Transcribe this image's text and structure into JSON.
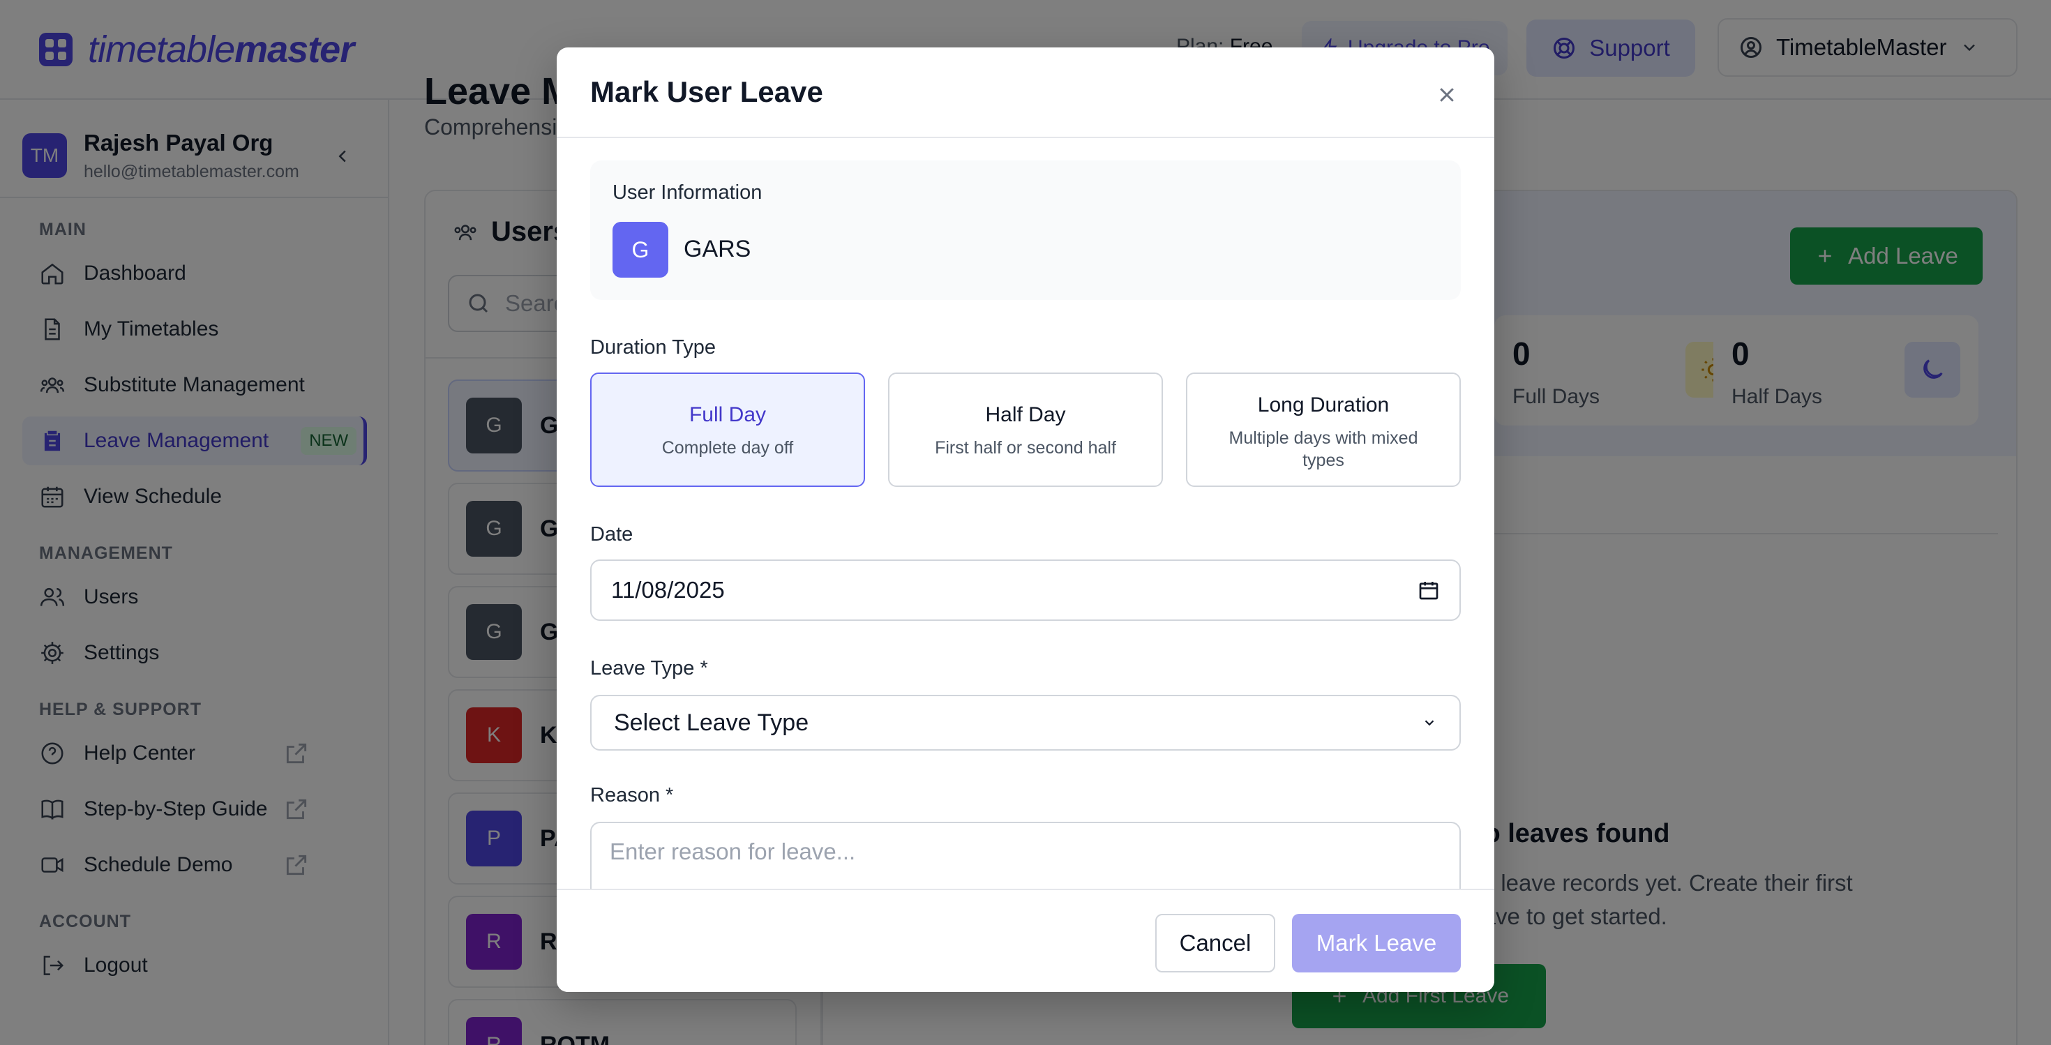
{
  "header": {
    "brand_light": "timetable",
    "brand_bold": "master",
    "plan_label": "Plan:",
    "plan_value": "Free",
    "upgrade_label": "Upgrade to Pro",
    "support_label": "Support",
    "account_label": "TimetableMaster"
  },
  "sidebar": {
    "org_initials": "TM",
    "org_name": "Rajesh Payal Org",
    "org_email": "hello@timetablemaster.com",
    "sections": {
      "main": "MAIN",
      "management": "MANAGEMENT",
      "help": "HELP & SUPPORT",
      "account": "ACCOUNT"
    },
    "items": {
      "dashboard": "Dashboard",
      "my_timetables": "My Timetables",
      "substitute": "Substitute Management",
      "leave": "Leave Management",
      "leave_badge": "NEW",
      "view_schedule": "View Schedule",
      "users": "Users",
      "settings": "Settings",
      "help_center": "Help Center",
      "guide": "Step-by-Step Guide",
      "demo": "Schedule Demo",
      "logout": "Logout"
    }
  },
  "main": {
    "title": "Leave Management",
    "subtitle": "Comprehensive leave tracking",
    "users_title": "Users",
    "search_placeholder": "Search users...",
    "users": [
      {
        "initial": "G",
        "name": "GARS",
        "color": "#4b5563"
      },
      {
        "initial": "G",
        "name": "GAMS",
        "color": "#4b5563"
      },
      {
        "initial": "G",
        "name": "GHSS",
        "color": "#4b5563"
      },
      {
        "initial": "K",
        "name": "KMCS",
        "color": "#dc2626"
      },
      {
        "initial": "P",
        "name": "PAVS",
        "color": "#4f46e5"
      },
      {
        "initial": "R",
        "name": "RLMS",
        "color": "#7e22ce"
      },
      {
        "initial": "R",
        "name": "ROTM",
        "color": "#7e22ce"
      }
    ],
    "add_leave_label": "Add Leave",
    "stats": [
      {
        "value": "0",
        "label": "Full Days"
      },
      {
        "value": "0",
        "label": "Half Days"
      }
    ],
    "empty_title": "No leaves found",
    "empty_desc": "No leave records yet. Create their first leave to get started.",
    "add_first_label": "Add First Leave"
  },
  "modal": {
    "title": "Mark User Leave",
    "user_info_label": "User Information",
    "user_initial": "G",
    "user_name": "GARS",
    "duration_label": "Duration Type",
    "durations": [
      {
        "title": "Full Day",
        "desc": "Complete day off"
      },
      {
        "title": "Half Day",
        "desc": "First half or second half"
      },
      {
        "title": "Long Duration",
        "desc": "Multiple days with mixed types"
      }
    ],
    "selected_duration": "Full Day",
    "date_label": "Date",
    "date_value": "11/08/2025",
    "leave_type_label": "Leave Type *",
    "leave_type_value": "Select Leave Type",
    "reason_label": "Reason *",
    "reason_placeholder": "Enter reason for leave...",
    "cancel_label": "Cancel",
    "submit_label": "Mark Leave"
  },
  "colors": {
    "brand": "#4f46e5",
    "success": "#16a34a",
    "submit_disabled": "#a5a4f1",
    "overlay": "rgba(0,0,0,0.5)"
  }
}
